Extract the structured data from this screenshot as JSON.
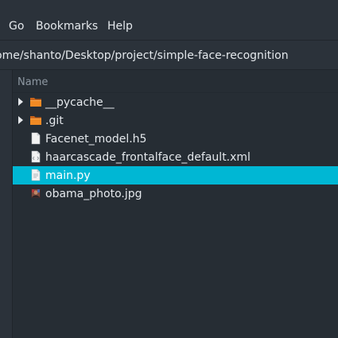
{
  "menu": {
    "items": [
      "Go",
      "Bookmarks",
      "Help"
    ]
  },
  "path": {
    "text": "ome/shanto/Desktop/project/simple-face-recognition"
  },
  "filelist": {
    "column_name": "Name",
    "rows": [
      {
        "name": "__pycache__",
        "type": "folder",
        "icon": "folder-icon",
        "expandable": true,
        "selected": false
      },
      {
        "name": ".git",
        "type": "folder",
        "icon": "folder-icon",
        "expandable": true,
        "selected": false
      },
      {
        "name": "Facenet_model.h5",
        "type": "file",
        "icon": "document-icon",
        "expandable": false,
        "selected": false
      },
      {
        "name": "haarcascade_frontalface_default.xml",
        "type": "file",
        "icon": "xml-file-icon",
        "expandable": false,
        "selected": false
      },
      {
        "name": "main.py",
        "type": "file",
        "icon": "python-file-icon",
        "expandable": false,
        "selected": true
      },
      {
        "name": "obama_photo.jpg",
        "type": "file",
        "icon": "image-file-icon",
        "expandable": false,
        "selected": false
      }
    ]
  },
  "colors": {
    "background": "#2b323a",
    "pane": "#262d34",
    "selection": "#00b7d4",
    "folder": "#f08a24"
  }
}
